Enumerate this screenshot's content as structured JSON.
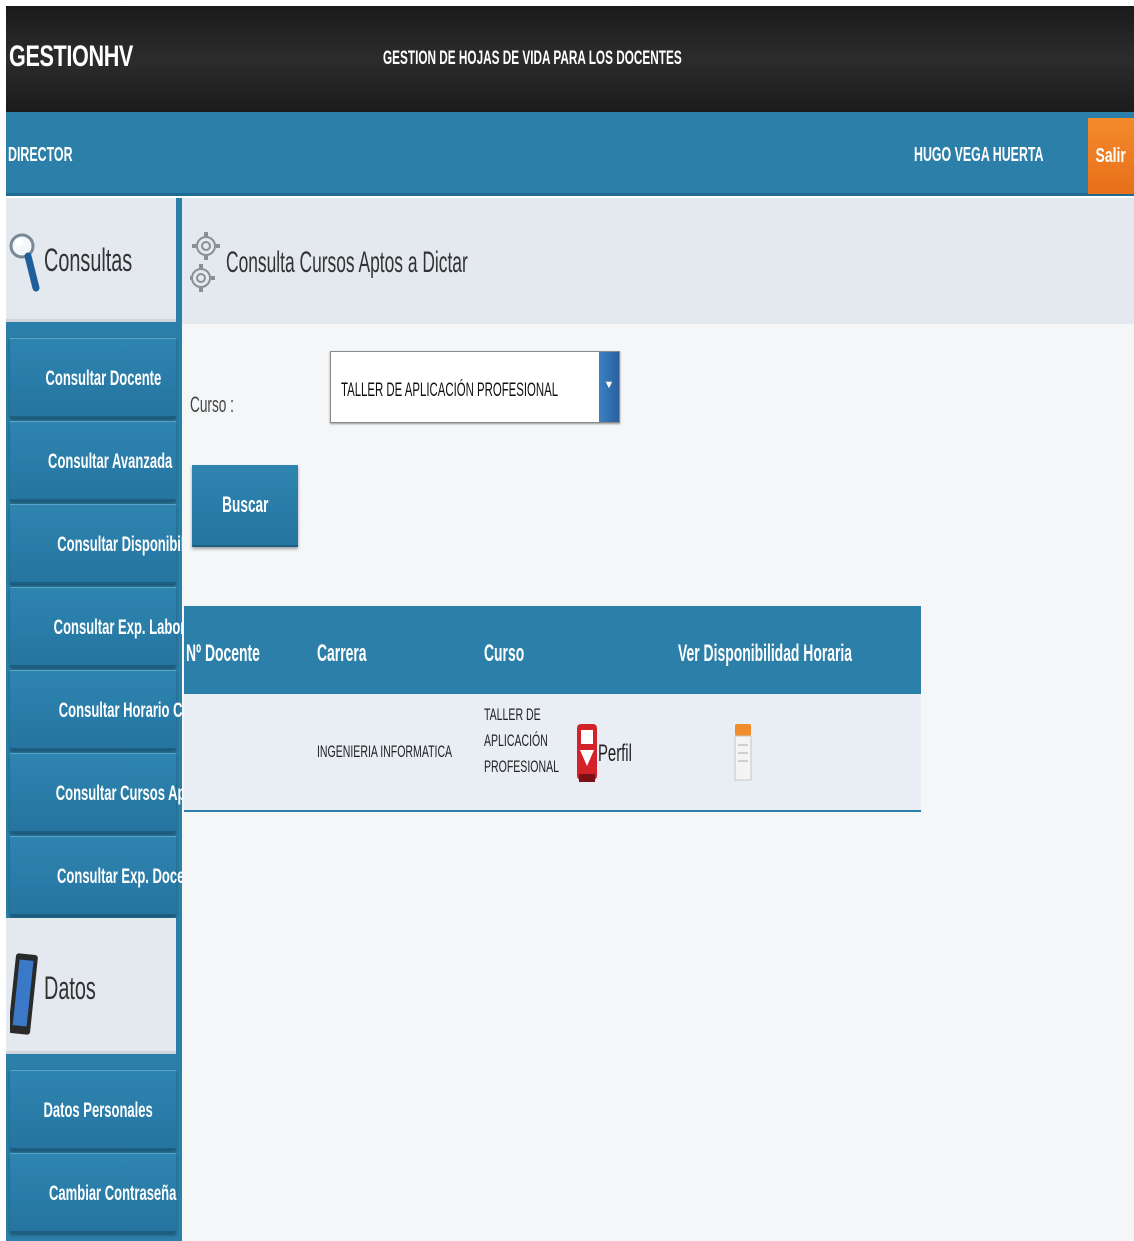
{
  "header": {
    "logo": "GESTIONHV",
    "subtitle": "GESTION DE HOJAS DE VIDA PARA LOS DOCENTES"
  },
  "rolebar": {
    "role": "DIRECTOR",
    "user": "HUGO VEGA HUERTA",
    "exit_label": "Salir"
  },
  "sidebar": {
    "consultas_title": "Consultas",
    "consultas_items": [
      {
        "label": "Consultar Docente"
      },
      {
        "label": "Consultar Avanzada"
      },
      {
        "label": "Consultar Disponibilidad"
      },
      {
        "label": "Consultar Exp. Laboral"
      },
      {
        "label": "Consultar Horario Cursos"
      },
      {
        "label": "Consultar Cursos Aptos"
      },
      {
        "label": "Consultar Exp. Docencia"
      }
    ],
    "datos_title": "Datos",
    "datos_items": [
      {
        "label": "Datos Personales"
      },
      {
        "label": "Cambiar Contraseña"
      }
    ]
  },
  "main": {
    "title": "Consulta Cursos Aptos a Dictar",
    "curso_label": "Curso :",
    "curso_selected": "TALLER DE APLICACIÓN PROFESIONAL",
    "search_button": "Buscar"
  },
  "table": {
    "headers": [
      "Nº Docente",
      "Carrera",
      "Curso",
      "Ver Disponibilidad Horaria"
    ],
    "rows": [
      {
        "docente": "",
        "carrera": "INGENIERIA INFORMATICA",
        "curso_lines": [
          "TALLER DE",
          "APLICACIÓN",
          "PROFESIONAL"
        ],
        "perfil_label": "Perfil"
      }
    ]
  },
  "icons": {
    "consultas": "search-icon",
    "datos": "tablet-icon",
    "title": "gear-icon",
    "perfil": "pdf-download-icon",
    "disponibilidad": "calendar-icon"
  }
}
